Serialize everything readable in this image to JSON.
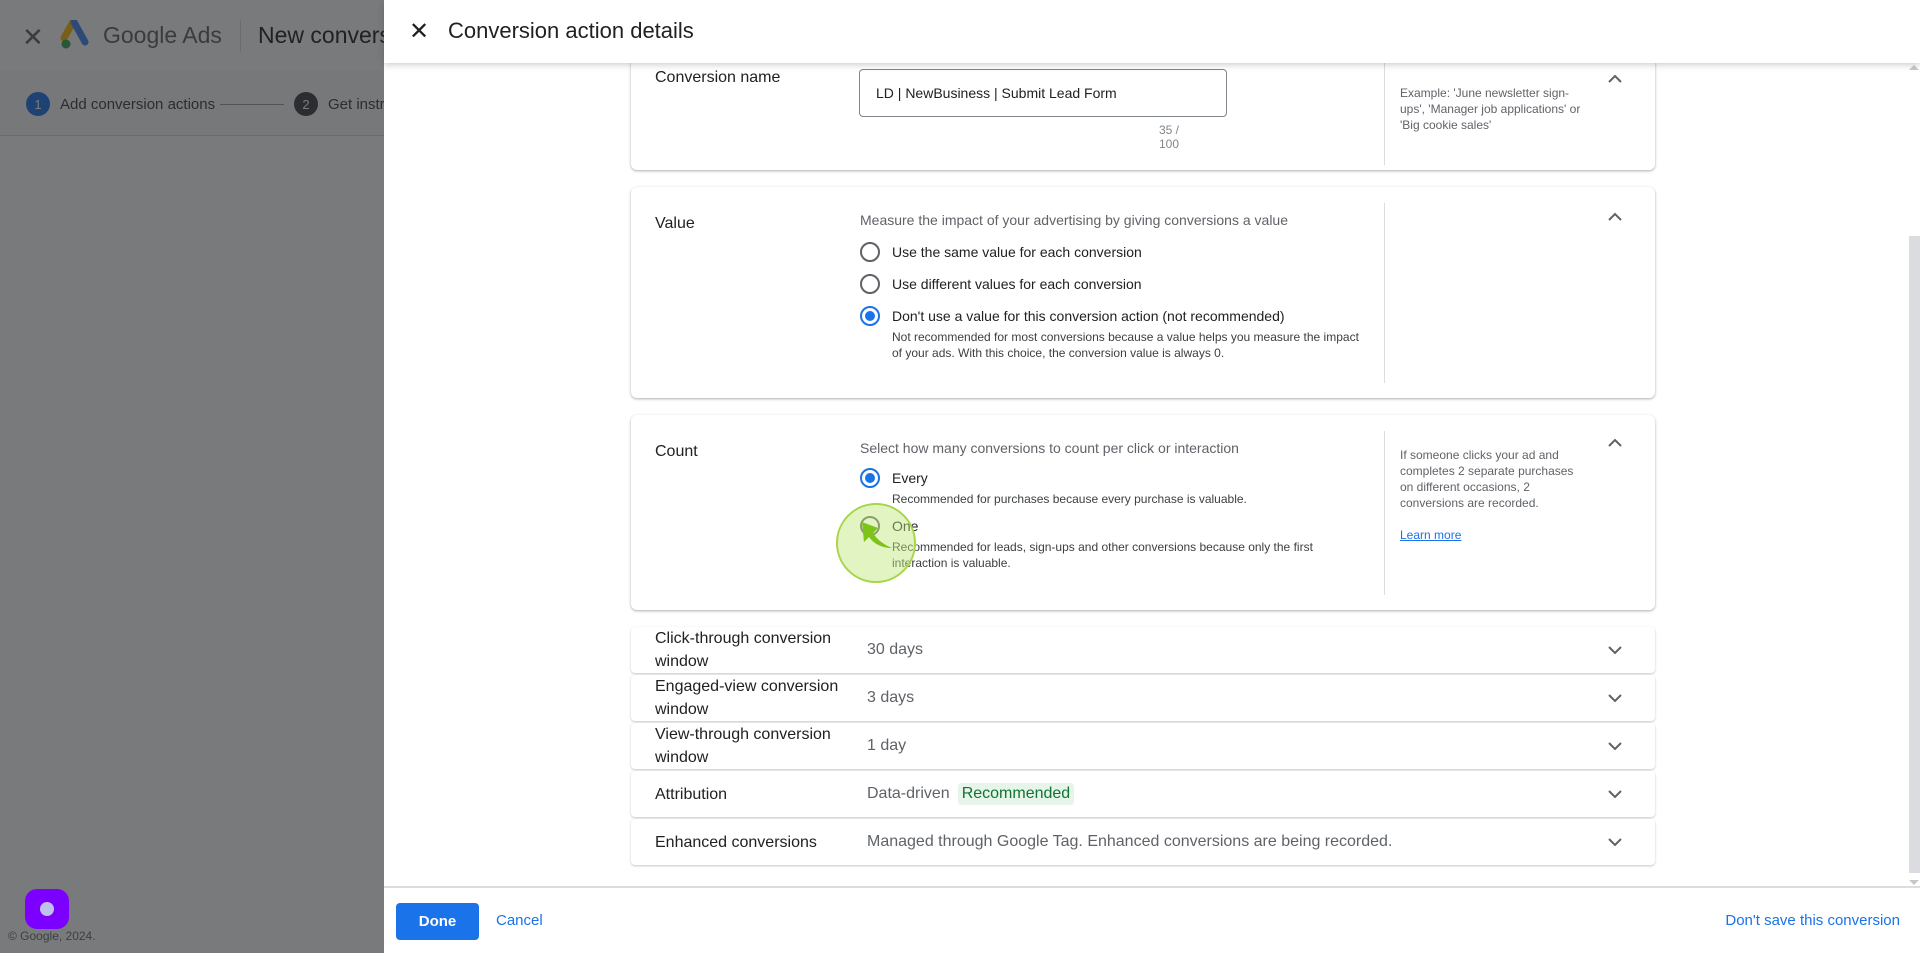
{
  "background_page": {
    "app_name": "Google Ads",
    "page_title": "New conversion action",
    "steps": [
      {
        "number": "1",
        "label": "Add conversion actions",
        "active": true
      },
      {
        "number": "2",
        "label": "Get instructions",
        "active": false
      }
    ],
    "copyright": "© Google, 2024."
  },
  "panel": {
    "title": "Conversion action details",
    "close_icon": "close-icon"
  },
  "conversion_name": {
    "label": "Conversion name",
    "value": "LD | NewBusiness | Submit Lead Form",
    "counter": "35 / 100",
    "help": "Example: 'June newsletter sign-ups', 'Manager job applications' or 'Big cookie sales'"
  },
  "value_section": {
    "label": "Value",
    "description": "Measure the impact of your advertising by giving conversions a value",
    "options": [
      {
        "label": "Use the same value for each conversion",
        "checked": false,
        "sub": ""
      },
      {
        "label": "Use different values for each conversion",
        "checked": false,
        "sub": ""
      },
      {
        "label": "Don't use a value for this conversion action (not recommended)",
        "checked": true,
        "sub": "Not recommended for most conversions because a value helps you measure the impact of your ads. With this choice, the conversion value is always 0."
      }
    ]
  },
  "count_section": {
    "label": "Count",
    "description": "Select how many conversions to count per click or interaction",
    "options": [
      {
        "label": "Every",
        "checked": true,
        "sub": "Recommended for purchases because every purchase is valuable."
      },
      {
        "label": "One",
        "checked": false,
        "sub": "Recommended for leads, sign-ups and other conversions because only the first interaction is valuable."
      }
    ],
    "help": "If someone clicks your ad and completes 2 separate purchases on different occasions, 2 conversions are recorded.",
    "learn_more": "Learn more"
  },
  "rows": [
    {
      "label": "Click-through conversion window",
      "value": "30 days"
    },
    {
      "label": "Engaged-view conversion window",
      "value": "3 days"
    },
    {
      "label": "View-through conversion window",
      "value": "1 day"
    },
    {
      "label": "Attribution",
      "value": "Data-driven",
      "badge": "Recommended"
    },
    {
      "label": "Enhanced conversions",
      "value": "Managed through Google Tag. Enhanced conversions are being recorded."
    }
  ],
  "footer": {
    "done": "Done",
    "cancel": "Cancel",
    "dont_save": "Don't save this conversion"
  },
  "colors": {
    "primary": "#1a73e8",
    "recommended_bg": "#e6f4ea",
    "recommended_text": "#137333",
    "launcher": "#7b00ff"
  }
}
